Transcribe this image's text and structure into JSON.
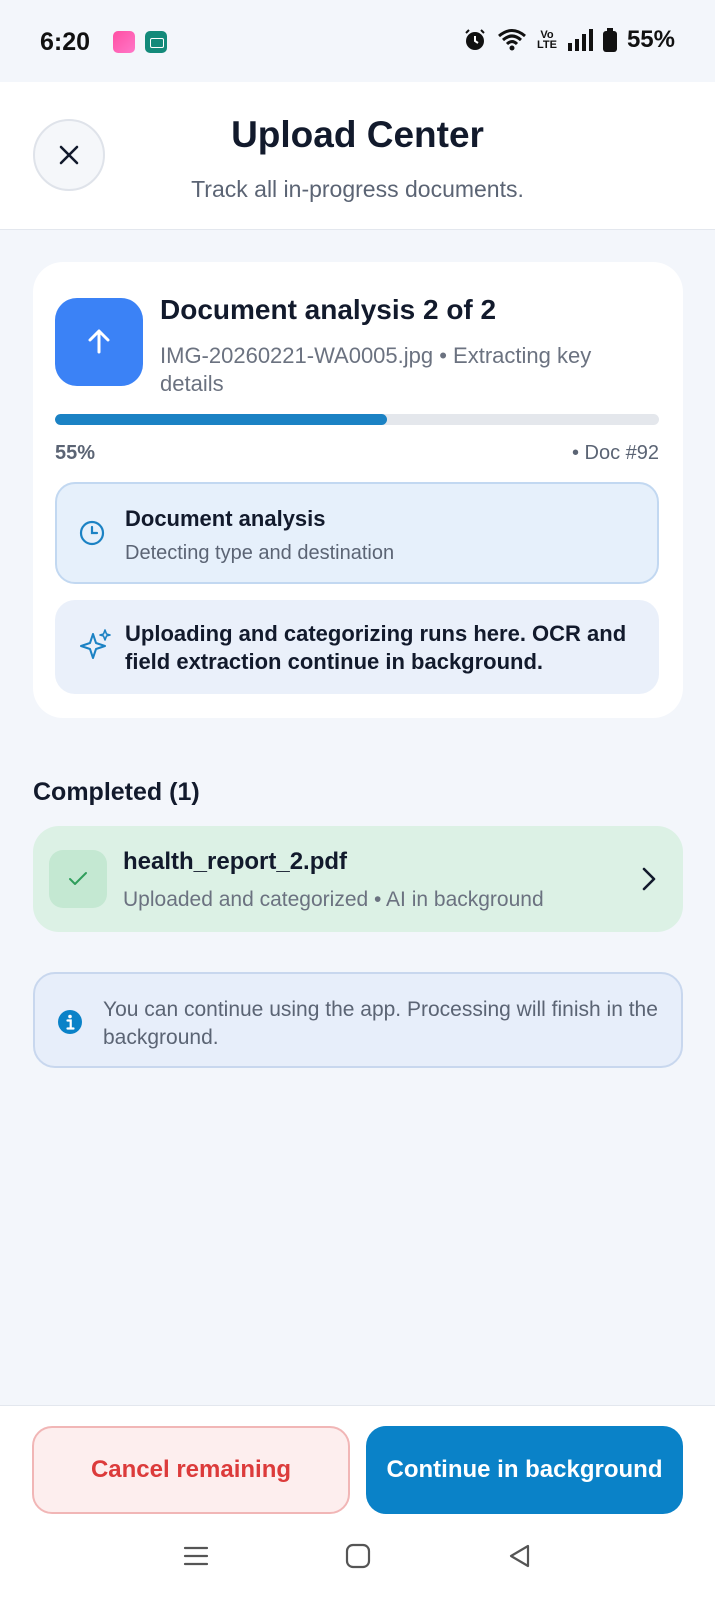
{
  "status_bar": {
    "time": "6:20",
    "volte_top": "Vo",
    "volte_bottom": "LTE",
    "battery": "55%"
  },
  "header": {
    "title": "Upload Center",
    "subtitle": "Track all in-progress documents."
  },
  "progress_card": {
    "title": "Document analysis 2 of 2",
    "file_info": "IMG-20260221-WA0005.jpg • Extracting key details",
    "progress_fraction": 0.55,
    "percent_label": "55%",
    "doc_label": "• Doc #92",
    "step": {
      "title": "Document analysis",
      "subtitle": "Detecting type and destination"
    },
    "note": "Uploading and categorizing runs here. OCR and field extraction continue in background."
  },
  "completed": {
    "heading": "Completed (1)",
    "items": [
      {
        "name": "health_report_2.pdf",
        "status": "Uploaded and categorized • AI in background"
      }
    ]
  },
  "info_banner": {
    "text": "You can continue using the app. Processing will finish in the background."
  },
  "footer": {
    "cancel_label": "Cancel remaining",
    "continue_label": "Continue in background"
  },
  "icons": {
    "close": "close-icon",
    "upload": "arrow-up-icon",
    "clock": "clock-icon",
    "sparkle": "sparkles-icon",
    "check": "check-icon",
    "chevron": "chevron-right-icon",
    "info": "info-icon"
  },
  "colors": {
    "accent": "#0a82c8",
    "upload_icon_bg": "#3b82f6",
    "success_bg": "#dcf1e5",
    "danger": "#dc3b3b"
  }
}
